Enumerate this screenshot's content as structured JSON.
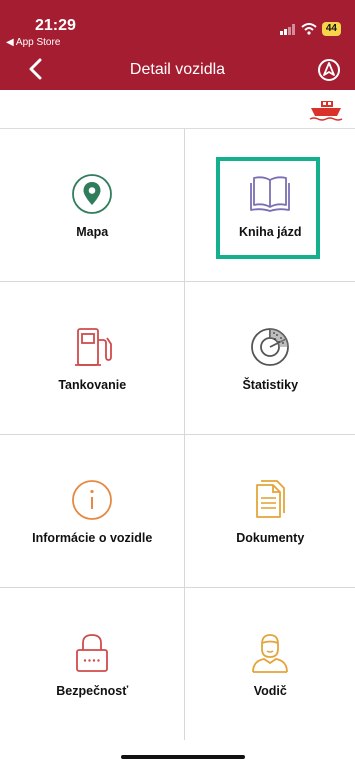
{
  "status_bar": {
    "time": "21:29",
    "back_app": "◀ App Store",
    "battery": "44"
  },
  "header": {
    "title": "Detail vozidla",
    "color": "#a51d31"
  },
  "menu": {
    "items": [
      {
        "label": "Mapa",
        "icon": "map-pin-icon"
      },
      {
        "label": "Kniha jázd",
        "icon": "book-icon"
      },
      {
        "label": "Tankovanie",
        "icon": "fuel-pump-icon"
      },
      {
        "label": "Štatistiky",
        "icon": "pie-chart-icon"
      },
      {
        "label": "Informácie o vozidle",
        "icon": "info-icon"
      },
      {
        "label": "Dokumenty",
        "icon": "document-icon"
      },
      {
        "label": "Bezpečnosť",
        "icon": "lock-icon"
      },
      {
        "label": "Vodič",
        "icon": "driver-icon"
      }
    ]
  },
  "colors": {
    "accent": "#a51d31",
    "highlight": "#14b08e",
    "map": "#2f7d5b",
    "book": "#7b6fb3",
    "fuel": "#cf4b4b",
    "stats": "#555555",
    "info": "#e58a44",
    "documents": "#e3a53a",
    "lock": "#cf4b4b",
    "driver": "#e3a53a"
  }
}
